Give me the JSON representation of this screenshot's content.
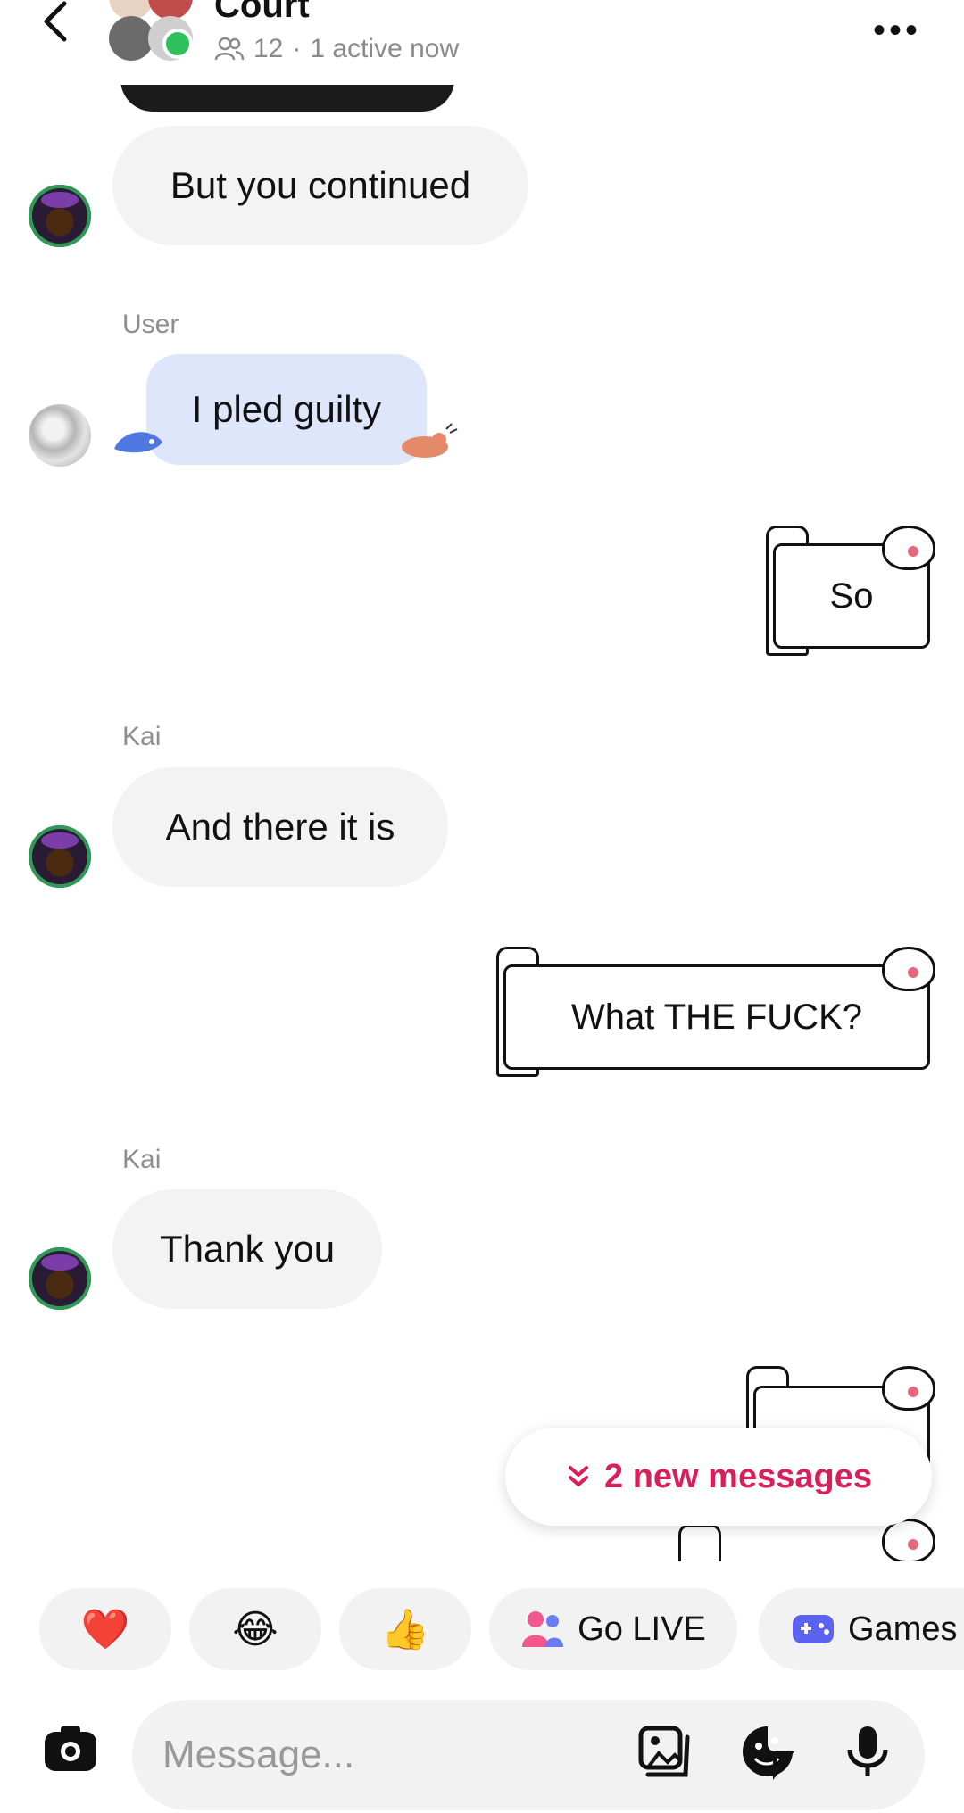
{
  "header": {
    "title": "Court",
    "member_count": "12",
    "subtitle_sep": "·",
    "active_text": "1 active now"
  },
  "messages": [
    {
      "type": "received",
      "text": "But you continued"
    },
    {
      "type": "received",
      "sender": "User",
      "text": "I pled guilty"
    },
    {
      "type": "sent_sticker",
      "text": "So"
    },
    {
      "type": "received",
      "sender": "Kai",
      "text": "And there it is"
    },
    {
      "type": "sent_sticker",
      "text": "What THE FUCK?"
    },
    {
      "type": "received",
      "sender": "Kai",
      "text": "Thank you"
    }
  ],
  "new_messages_label": "2 new messages",
  "quick_actions": [
    {
      "icon": "heart-icon",
      "emoji": "❤️"
    },
    {
      "icon": "laughing-emoji-icon",
      "emoji": "😂"
    },
    {
      "icon": "thumbs-up-icon",
      "emoji": "👍"
    },
    {
      "icon": "go-live-icon",
      "label": "Go LIVE"
    },
    {
      "icon": "gamepad-icon",
      "label": "Games"
    }
  ],
  "composer": {
    "placeholder": "Message..."
  },
  "colors": {
    "accent_red": "#d81f5b",
    "online_green": "#2ec05c",
    "user_bubble": "#dde6fb",
    "received_bubble": "#f3f3f3"
  }
}
